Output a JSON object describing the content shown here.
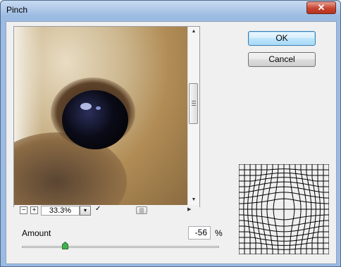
{
  "window": {
    "title": "Pinch",
    "close_glyph": "✕"
  },
  "preview": {
    "zoom": "33.3%",
    "zoom_out_label": "−",
    "zoom_in_label": "+",
    "dropdown_glyph": "▾",
    "commit_glyph": "✓",
    "scroll_up_glyph": "▲",
    "scroll_down_glyph": "▼",
    "scroll_right_glyph": "▶",
    "hthumb_glyph": "|||",
    "image": "dog eye close-up"
  },
  "buttons": {
    "ok": "OK",
    "cancel": "Cancel"
  },
  "amount": {
    "label": "Amount",
    "value": "-56",
    "unit": "%",
    "slider_min": -100,
    "slider_max": 100,
    "slider_value": -56
  },
  "colors": {
    "title_bar": "#9cbbe2",
    "close_button": "#c7442f",
    "ok_border": "#3c7fb1",
    "slider_thumb": "#3cb44b"
  }
}
